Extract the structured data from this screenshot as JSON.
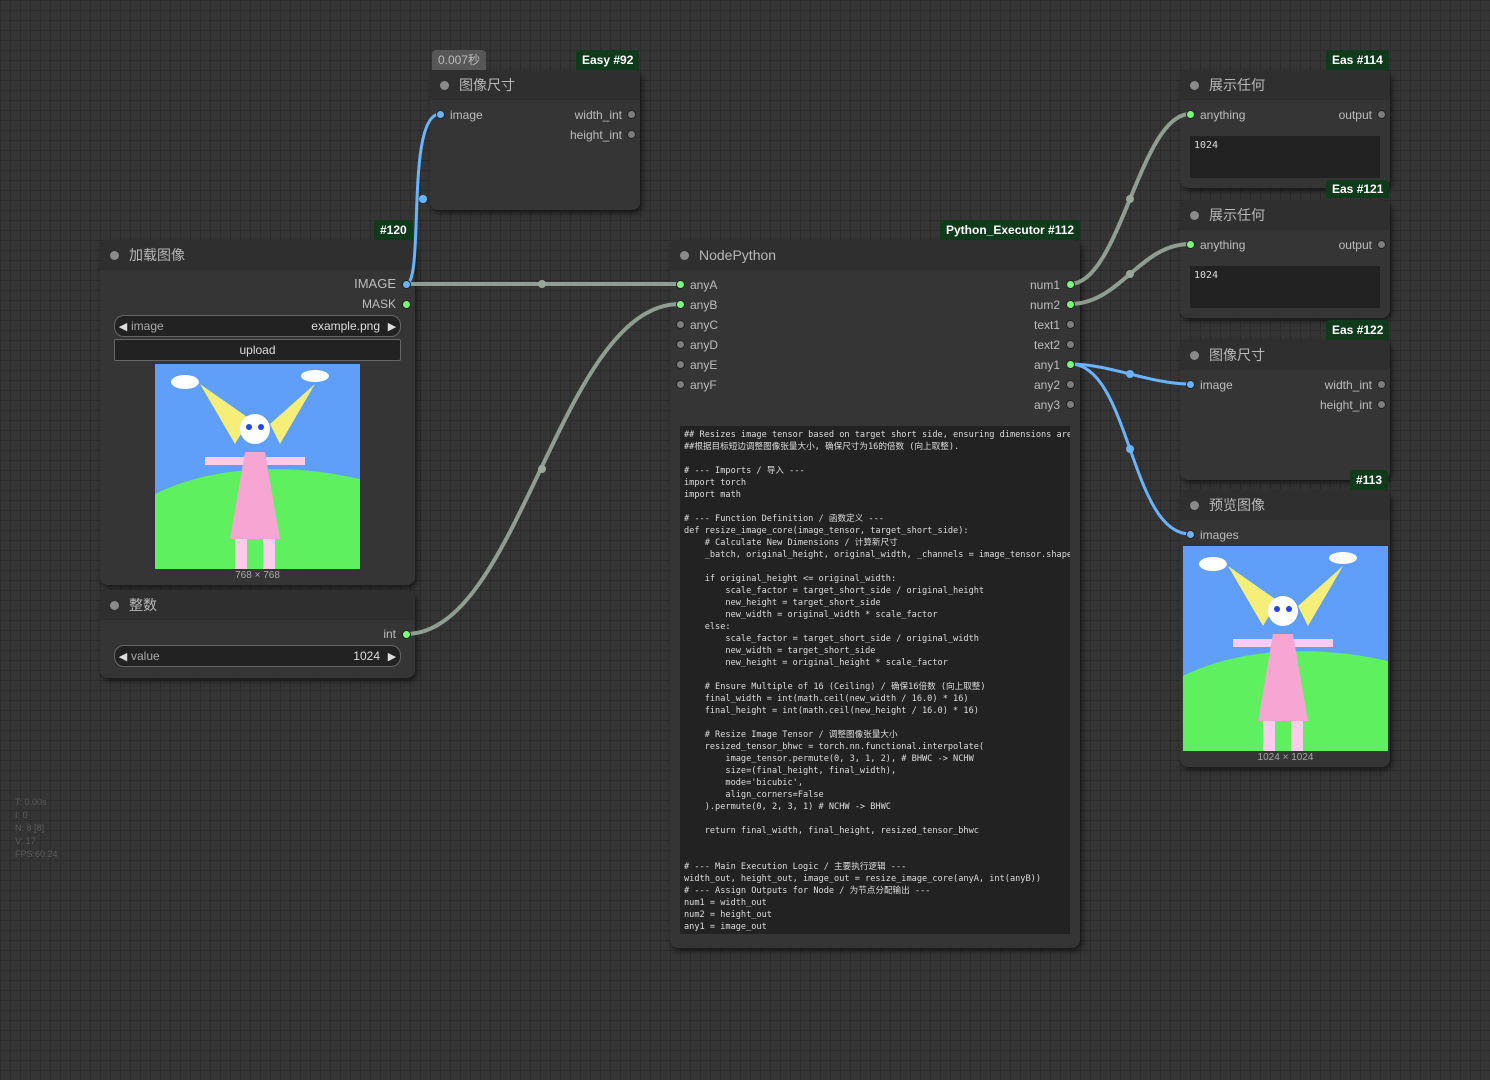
{
  "nodes": {
    "size92": {
      "title": "图像尺寸",
      "badge_type": "Easy",
      "badge_id": "#92",
      "timing": "0.007秒",
      "inputs": [
        "image"
      ],
      "outputs": [
        "width_int",
        "height_int"
      ]
    },
    "load120": {
      "title": "加载图像",
      "badge_id": "#120",
      "outputs": [
        "IMAGE",
        "MASK"
      ],
      "image_widget": {
        "label": "image",
        "value": "example.png"
      },
      "upload_label": "upload",
      "caption": "768 × 768"
    },
    "int": {
      "title": "整数",
      "outputs": [
        "int"
      ],
      "value_widget": {
        "label": "value",
        "value": "1024"
      }
    },
    "python112": {
      "title": "NodePython",
      "badge_type": "Python_Executor",
      "badge_id": "#112",
      "inputs": [
        "anyA",
        "anyB",
        "anyC",
        "anyD",
        "anyE",
        "anyF"
      ],
      "outputs": [
        "num1",
        "num2",
        "text1",
        "text2",
        "any1",
        "any2",
        "any3"
      ]
    },
    "show114": {
      "title": "展示任何",
      "badge_type": "Eas",
      "badge_id": "#114",
      "input": "anything",
      "output": "output",
      "text": "1024"
    },
    "show121": {
      "title": "展示任何",
      "badge_type": "Eas",
      "badge_id": "#121",
      "input": "anything",
      "output": "output",
      "text": "1024"
    },
    "size122": {
      "title": "图像尺寸",
      "badge_type": "Eas",
      "badge_id": "#122",
      "inputs": [
        "image"
      ],
      "outputs": [
        "width_int",
        "height_int"
      ]
    },
    "preview113": {
      "title": "预览图像",
      "badge_id": "#113",
      "inputs": [
        "images"
      ],
      "caption": "1024 × 1024"
    }
  },
  "code": "## Resizes image tensor based on target short side, ensuring dimensions are\n##根据目标短边调整图像张量大小, 确保尺寸为16的倍数 (向上取整).\n\n# --- Imports / 导入 ---\nimport torch\nimport math\n\n# --- Function Definition / 函数定义 ---\ndef resize_image_core(image_tensor, target_short_side):\n    # Calculate New Dimensions / 计算新尺寸\n    _batch, original_height, original_width, _channels = image_tensor.shape\n\n    if original_height <= original_width:\n        scale_factor = target_short_side / original_height\n        new_height = target_short_side\n        new_width = original_width * scale_factor\n    else:\n        scale_factor = target_short_side / original_width\n        new_width = target_short_side\n        new_height = original_height * scale_factor\n\n    # Ensure Multiple of 16 (Ceiling) / 确保16倍数 (向上取整)\n    final_width = int(math.ceil(new_width / 16.0) * 16)\n    final_height = int(math.ceil(new_height / 16.0) * 16)\n\n    # Resize Image Tensor / 调整图像张量大小\n    resized_tensor_bhwc = torch.nn.functional.interpolate(\n        image_tensor.permute(0, 3, 1, 2), # BHWC -> NCHW\n        size=(final_height, final_width),\n        mode='bicubic',\n        align_corners=False\n    ).permute(0, 2, 3, 1) # NCHW -> BHWC\n\n    return final_width, final_height, resized_tensor_bhwc\n\n\n# --- Main Execution Logic / 主要执行逻辑 ---\nwidth_out, height_out, image_out = resize_image_core(anyA, int(anyB))\n# --- Assign Outputs for Node / 为节点分配输出 ---\nnum1 = width_out\nnum2 = height_out\nany1 = image_out",
  "stats": [
    "T: 0.00s",
    "I: 0",
    "N: 8 [8]",
    "V: 17",
    "FPS:60.24"
  ],
  "colors": {
    "background": "#353535",
    "node": "#353535",
    "title": "#2f2f2f",
    "badge": "#0f3a1c",
    "wire_gray": "#9aa89c",
    "wire_blue": "#6ab4ff",
    "slot_green": "#7cfa7c"
  }
}
